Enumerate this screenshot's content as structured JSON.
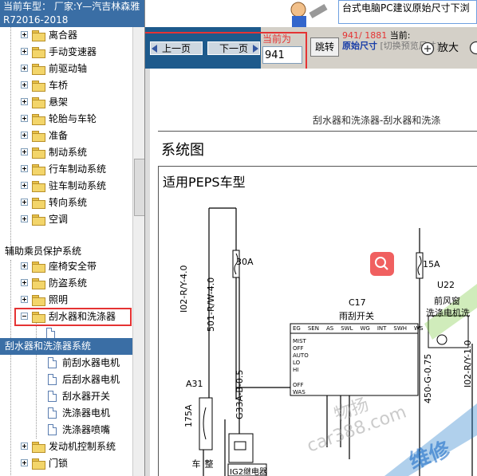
{
  "tree": {
    "header": "当前车型： 厂家:Y—汽吉林森雅R72016-2018",
    "items": [
      {
        "label": "离合器",
        "level": 2
      },
      {
        "label": "手动变速器",
        "level": 2
      },
      {
        "label": "前驱动轴",
        "level": 2
      },
      {
        "label": "车桥",
        "level": 2
      },
      {
        "label": "悬架",
        "level": 2
      },
      {
        "label": "轮胎与车轮",
        "level": 2
      },
      {
        "label": "准备",
        "level": 2
      },
      {
        "label": "制动系统",
        "level": 2
      },
      {
        "label": "行车制动系统",
        "level": 2
      },
      {
        "label": "驻车制动系统",
        "level": 2
      },
      {
        "label": "转向系统",
        "level": 2
      },
      {
        "label": "空调",
        "level": 2
      }
    ],
    "group_label": "辅助乘员保护系统",
    "items2": [
      {
        "label": "座椅安全带"
      },
      {
        "label": "防盗系统"
      },
      {
        "label": "照明"
      },
      {
        "label": "刮水器和洗涤器"
      }
    ],
    "selected": "刮水器和洗涤器系统",
    "children": [
      {
        "label": "前刮水器电机"
      },
      {
        "label": "后刮水器电机"
      },
      {
        "label": "刮水器开关"
      },
      {
        "label": "洗涤器电机"
      },
      {
        "label": "洗涤器喷嘴"
      }
    ],
    "items3": [
      {
        "label": "发动机控制系统"
      },
      {
        "label": "门锁"
      }
    ]
  },
  "toolbar": {
    "prev_label": "上一页",
    "next_label": "下一页",
    "current_label": "当前为",
    "page_value": "941",
    "jump_label": "跳转",
    "page_count": "941/ 1881",
    "current_short": "当前:",
    "original_size": "原始尺寸",
    "switch_preview": "[切换预览尺寸]",
    "zoom_label": "放大",
    "banner_text": "台式电脑PC建议原始尺寸下浏"
  },
  "document": {
    "page_header": "刮水器和洗涤器-刮水器和洗涤",
    "section_title": "系统图",
    "subtitle": "适用PEPS车型",
    "fuse1": "30A",
    "fuse2": "15A",
    "wire1": "I02-R/Y-4.0",
    "wire2": "501-R/W-4.0",
    "wire3": "G33A-B-0.5",
    "wire4": "450-G-0.75",
    "wire5": "I02-R/Y-1.0",
    "conn_c17": "C17",
    "switch_label": "雨刮开关",
    "conn_u22": "U22",
    "motor_label1": "前风窗",
    "motor_label2": "洗涤电机洗",
    "conn_a31": "A31",
    "fuse3": "175A",
    "body_label": "整车",
    "relay_label": "IG2继电器",
    "switch_cols": [
      "EG",
      "SEN",
      "AS",
      "SWL",
      "WG",
      "INT",
      "SWH",
      "WS"
    ],
    "switch_rows": [
      "MIST",
      "OFF",
      "AUTO",
      "LO",
      "HI",
      "OFF",
      "WAS"
    ],
    "watermark1": "物扬",
    "watermark2": "car388.com",
    "watermark3": "维修"
  },
  "colors": {
    "header_bg": "#3a6ea5",
    "nav_bg": "#1d5a8c",
    "highlight": "#e53333",
    "search_button": "#f06060"
  }
}
